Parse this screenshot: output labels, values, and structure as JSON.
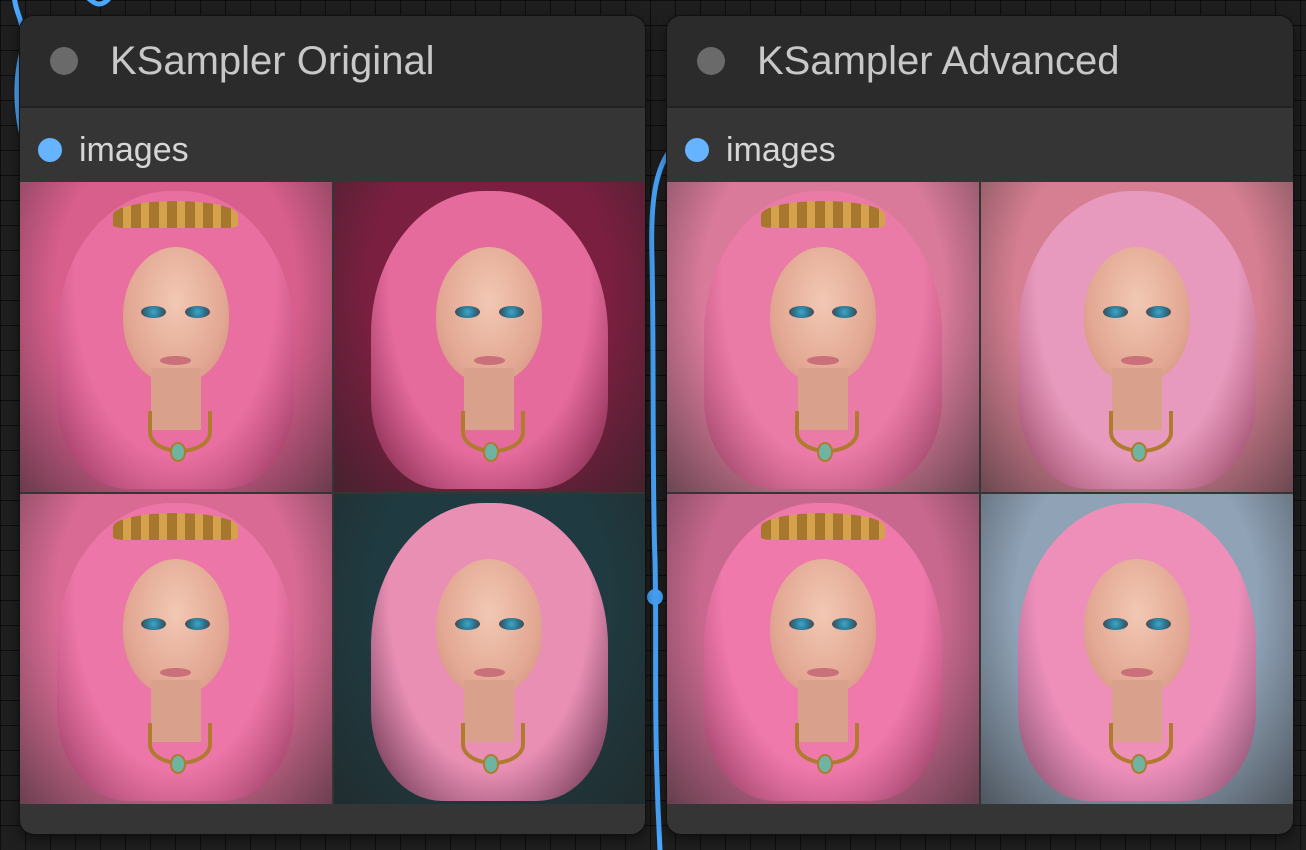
{
  "canvas": {
    "background": "#1f1f1f",
    "link_color": "#4aa8ff"
  },
  "nodes": [
    {
      "title": "KSampler Original",
      "status_color": "#6a6a6a",
      "output": {
        "label": "images",
        "dot_color": "#66b3ff"
      },
      "images": [
        {
          "background": "#d85e8c",
          "hair": "#e86fa0",
          "crown": true
        },
        {
          "background": "#7a1f3f",
          "hair": "#e56b9c",
          "crown": false
        },
        {
          "background": "#d86a93",
          "hair": "#ec76a7",
          "crown": true
        },
        {
          "background": "#1f3a40",
          "hair": "#e98fb4",
          "crown": false
        }
      ]
    },
    {
      "title": "KSampler Advanced",
      "status_color": "#6a6a6a",
      "output": {
        "label": "images",
        "dot_color": "#66b3ff"
      },
      "images": [
        {
          "background": "#d97a9a",
          "hair": "#ea7aa6",
          "crown": true
        },
        {
          "background": "#d77f92",
          "hair": "#e79abd",
          "crown": false
        },
        {
          "background": "#c9688e",
          "hair": "#ef79ab",
          "crown": true
        },
        {
          "background": "#8fa2b6",
          "hair": "#ee8fba",
          "crown": false
        }
      ]
    }
  ]
}
